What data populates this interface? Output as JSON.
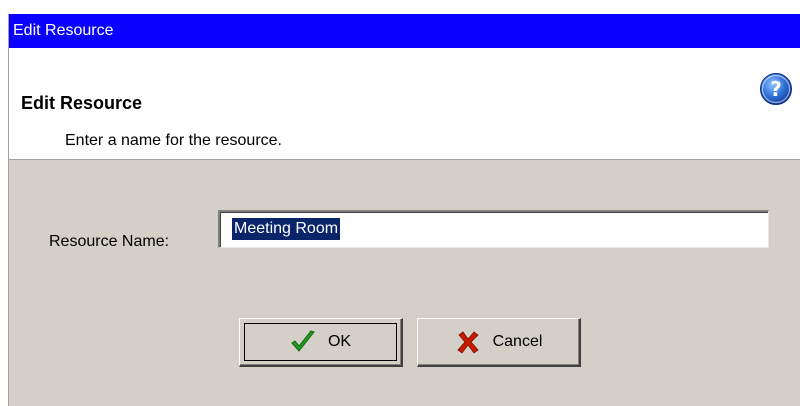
{
  "window": {
    "title": "Edit Resource"
  },
  "header": {
    "heading": "Edit Resource",
    "subtext": "Enter a name for the resource.",
    "help_icon": "help-icon"
  },
  "form": {
    "resource_name_label": "Resource Name:",
    "resource_name_value": "Meeting Room"
  },
  "buttons": {
    "ok_label": "OK",
    "ok_icon": "checkmark-icon",
    "cancel_label": "Cancel",
    "cancel_icon": "x-icon"
  },
  "colors": {
    "titlebar": "#0a00ff",
    "dialog_bg": "#d4d0c8",
    "selection": "#0a246a",
    "check_green": "#1f9a1f",
    "cancel_red": "#c81a00"
  }
}
